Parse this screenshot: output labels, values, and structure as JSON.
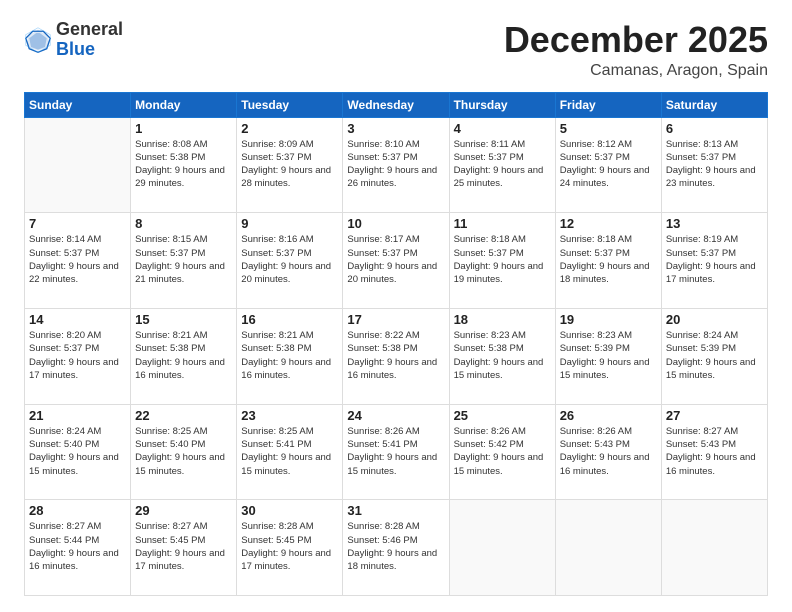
{
  "header": {
    "logo_general": "General",
    "logo_blue": "Blue",
    "month": "December 2025",
    "location": "Camanas, Aragon, Spain"
  },
  "weekdays": [
    "Sunday",
    "Monday",
    "Tuesday",
    "Wednesday",
    "Thursday",
    "Friday",
    "Saturday"
  ],
  "weeks": [
    [
      {
        "day": "",
        "info": ""
      },
      {
        "day": "1",
        "info": "Sunrise: 8:08 AM\nSunset: 5:38 PM\nDaylight: 9 hours\nand 29 minutes."
      },
      {
        "day": "2",
        "info": "Sunrise: 8:09 AM\nSunset: 5:37 PM\nDaylight: 9 hours\nand 28 minutes."
      },
      {
        "day": "3",
        "info": "Sunrise: 8:10 AM\nSunset: 5:37 PM\nDaylight: 9 hours\nand 26 minutes."
      },
      {
        "day": "4",
        "info": "Sunrise: 8:11 AM\nSunset: 5:37 PM\nDaylight: 9 hours\nand 25 minutes."
      },
      {
        "day": "5",
        "info": "Sunrise: 8:12 AM\nSunset: 5:37 PM\nDaylight: 9 hours\nand 24 minutes."
      },
      {
        "day": "6",
        "info": "Sunrise: 8:13 AM\nSunset: 5:37 PM\nDaylight: 9 hours\nand 23 minutes."
      }
    ],
    [
      {
        "day": "7",
        "info": "Sunrise: 8:14 AM\nSunset: 5:37 PM\nDaylight: 9 hours\nand 22 minutes."
      },
      {
        "day": "8",
        "info": "Sunrise: 8:15 AM\nSunset: 5:37 PM\nDaylight: 9 hours\nand 21 minutes."
      },
      {
        "day": "9",
        "info": "Sunrise: 8:16 AM\nSunset: 5:37 PM\nDaylight: 9 hours\nand 20 minutes."
      },
      {
        "day": "10",
        "info": "Sunrise: 8:17 AM\nSunset: 5:37 PM\nDaylight: 9 hours\nand 20 minutes."
      },
      {
        "day": "11",
        "info": "Sunrise: 8:18 AM\nSunset: 5:37 PM\nDaylight: 9 hours\nand 19 minutes."
      },
      {
        "day": "12",
        "info": "Sunrise: 8:18 AM\nSunset: 5:37 PM\nDaylight: 9 hours\nand 18 minutes."
      },
      {
        "day": "13",
        "info": "Sunrise: 8:19 AM\nSunset: 5:37 PM\nDaylight: 9 hours\nand 17 minutes."
      }
    ],
    [
      {
        "day": "14",
        "info": "Sunrise: 8:20 AM\nSunset: 5:37 PM\nDaylight: 9 hours\nand 17 minutes."
      },
      {
        "day": "15",
        "info": "Sunrise: 8:21 AM\nSunset: 5:38 PM\nDaylight: 9 hours\nand 16 minutes."
      },
      {
        "day": "16",
        "info": "Sunrise: 8:21 AM\nSunset: 5:38 PM\nDaylight: 9 hours\nand 16 minutes."
      },
      {
        "day": "17",
        "info": "Sunrise: 8:22 AM\nSunset: 5:38 PM\nDaylight: 9 hours\nand 16 minutes."
      },
      {
        "day": "18",
        "info": "Sunrise: 8:23 AM\nSunset: 5:38 PM\nDaylight: 9 hours\nand 15 minutes."
      },
      {
        "day": "19",
        "info": "Sunrise: 8:23 AM\nSunset: 5:39 PM\nDaylight: 9 hours\nand 15 minutes."
      },
      {
        "day": "20",
        "info": "Sunrise: 8:24 AM\nSunset: 5:39 PM\nDaylight: 9 hours\nand 15 minutes."
      }
    ],
    [
      {
        "day": "21",
        "info": "Sunrise: 8:24 AM\nSunset: 5:40 PM\nDaylight: 9 hours\nand 15 minutes."
      },
      {
        "day": "22",
        "info": "Sunrise: 8:25 AM\nSunset: 5:40 PM\nDaylight: 9 hours\nand 15 minutes."
      },
      {
        "day": "23",
        "info": "Sunrise: 8:25 AM\nSunset: 5:41 PM\nDaylight: 9 hours\nand 15 minutes."
      },
      {
        "day": "24",
        "info": "Sunrise: 8:26 AM\nSunset: 5:41 PM\nDaylight: 9 hours\nand 15 minutes."
      },
      {
        "day": "25",
        "info": "Sunrise: 8:26 AM\nSunset: 5:42 PM\nDaylight: 9 hours\nand 15 minutes."
      },
      {
        "day": "26",
        "info": "Sunrise: 8:26 AM\nSunset: 5:43 PM\nDaylight: 9 hours\nand 16 minutes."
      },
      {
        "day": "27",
        "info": "Sunrise: 8:27 AM\nSunset: 5:43 PM\nDaylight: 9 hours\nand 16 minutes."
      }
    ],
    [
      {
        "day": "28",
        "info": "Sunrise: 8:27 AM\nSunset: 5:44 PM\nDaylight: 9 hours\nand 16 minutes."
      },
      {
        "day": "29",
        "info": "Sunrise: 8:27 AM\nSunset: 5:45 PM\nDaylight: 9 hours\nand 17 minutes."
      },
      {
        "day": "30",
        "info": "Sunrise: 8:28 AM\nSunset: 5:45 PM\nDaylight: 9 hours\nand 17 minutes."
      },
      {
        "day": "31",
        "info": "Sunrise: 8:28 AM\nSunset: 5:46 PM\nDaylight: 9 hours\nand 18 minutes."
      },
      {
        "day": "",
        "info": ""
      },
      {
        "day": "",
        "info": ""
      },
      {
        "day": "",
        "info": ""
      }
    ]
  ]
}
